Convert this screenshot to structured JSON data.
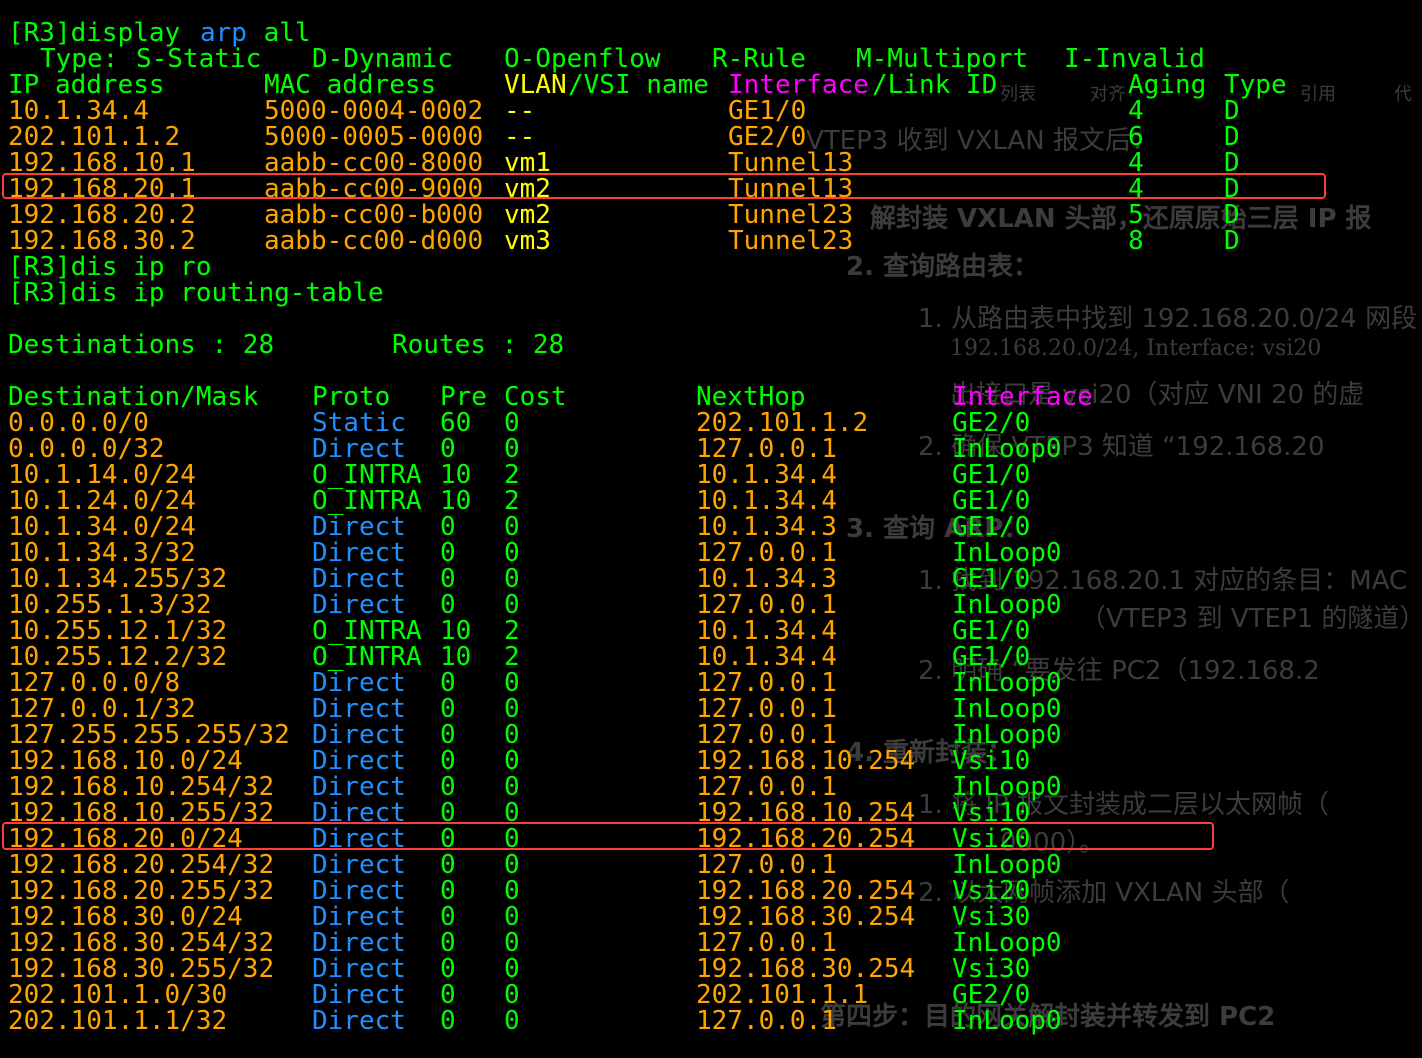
{
  "arp": {
    "command": "[R3]display arp all",
    "cmd_prefix": "[R3]display ",
    "cmd_arp": "arp",
    "cmd_all": " all",
    "legend": {
      "type": "Type:",
      "static": "S-Static",
      "dynamic": "D-Dynamic",
      "openflow": "O-Openflow",
      "rule": "R-Rule",
      "multiport": "M-Multiport",
      "invalid": "I-Invalid"
    },
    "headers": {
      "ip": "IP address",
      "mac": "MAC address",
      "vlan_vsi": "VLAN/VSI name",
      "vlan_vsi_a": "VLAN",
      "vlan_vsi_b": "/VSI name",
      "interface": "Interface",
      "link_id": "/Link ID",
      "aging": "Aging",
      "type": "Type"
    },
    "rows": [
      {
        "ip": "10.1.34.4",
        "mac": "5000-0004-0002",
        "vlan": "--",
        "iface": "GE1/0",
        "aging": "4",
        "type": "D"
      },
      {
        "ip": "202.101.1.2",
        "mac": "5000-0005-0000",
        "vlan": "--",
        "iface": "GE2/0",
        "aging": "6",
        "type": "D"
      },
      {
        "ip": "192.168.10.1",
        "mac": "aabb-cc00-8000",
        "vlan": "vm1",
        "iface": "Tunnel13",
        "aging": "4",
        "type": "D"
      },
      {
        "ip": "192.168.20.1",
        "mac": "aabb-cc00-9000",
        "vlan": "vm2",
        "iface": "Tunnel13",
        "aging": "4",
        "type": "D"
      },
      {
        "ip": "192.168.20.2",
        "mac": "aabb-cc00-b000",
        "vlan": "vm2",
        "iface": "Tunnel23",
        "aging": "5",
        "type": "D"
      },
      {
        "ip": "192.168.30.2",
        "mac": "aabb-cc00-d000",
        "vlan": "vm3",
        "iface": "Tunnel23",
        "aging": "8",
        "type": "D"
      }
    ]
  },
  "commands": {
    "dis_ip_ro": "[R3]dis ip ro",
    "dis_ip_routing_table": "[R3]dis ip routing-table"
  },
  "routing": {
    "destinations_label": "Destinations : 28",
    "routes_label": "Routes : 28",
    "headers": {
      "dest": "Destination/Mask",
      "proto": "Proto",
      "pre": "Pre",
      "cost": "Cost",
      "nexthop": "NextHop",
      "interface": "Interface"
    },
    "rows": [
      {
        "dest": "0.0.0.0/0",
        "proto": "Static",
        "pre": "60",
        "cost": "0",
        "nexthop": "202.101.1.2",
        "iface": "GE2/0"
      },
      {
        "dest": "0.0.0.0/32",
        "proto": "Direct",
        "pre": "0",
        "cost": "0",
        "nexthop": "127.0.0.1",
        "iface": "InLoop0"
      },
      {
        "dest": "10.1.14.0/24",
        "proto": "O_INTRA",
        "pre": "10",
        "cost": "2",
        "nexthop": "10.1.34.4",
        "iface": "GE1/0"
      },
      {
        "dest": "10.1.24.0/24",
        "proto": "O_INTRA",
        "pre": "10",
        "cost": "2",
        "nexthop": "10.1.34.4",
        "iface": "GE1/0"
      },
      {
        "dest": "10.1.34.0/24",
        "proto": "Direct",
        "pre": "0",
        "cost": "0",
        "nexthop": "10.1.34.3",
        "iface": "GE1/0"
      },
      {
        "dest": "10.1.34.3/32",
        "proto": "Direct",
        "pre": "0",
        "cost": "0",
        "nexthop": "127.0.0.1",
        "iface": "InLoop0"
      },
      {
        "dest": "10.1.34.255/32",
        "proto": "Direct",
        "pre": "0",
        "cost": "0",
        "nexthop": "10.1.34.3",
        "iface": "GE1/0"
      },
      {
        "dest": "10.255.1.3/32",
        "proto": "Direct",
        "pre": "0",
        "cost": "0",
        "nexthop": "127.0.0.1",
        "iface": "InLoop0"
      },
      {
        "dest": "10.255.12.1/32",
        "proto": "O_INTRA",
        "pre": "10",
        "cost": "2",
        "nexthop": "10.1.34.4",
        "iface": "GE1/0"
      },
      {
        "dest": "10.255.12.2/32",
        "proto": "O_INTRA",
        "pre": "10",
        "cost": "2",
        "nexthop": "10.1.34.4",
        "iface": "GE1/0"
      },
      {
        "dest": "127.0.0.0/8",
        "proto": "Direct",
        "pre": "0",
        "cost": "0",
        "nexthop": "127.0.0.1",
        "iface": "InLoop0"
      },
      {
        "dest": "127.0.0.1/32",
        "proto": "Direct",
        "pre": "0",
        "cost": "0",
        "nexthop": "127.0.0.1",
        "iface": "InLoop0"
      },
      {
        "dest": "127.255.255.255/32",
        "proto": "Direct",
        "pre": "0",
        "cost": "0",
        "nexthop": "127.0.0.1",
        "iface": "InLoop0"
      },
      {
        "dest": "192.168.10.0/24",
        "proto": "Direct",
        "pre": "0",
        "cost": "0",
        "nexthop": "192.168.10.254",
        "iface": "Vsi10"
      },
      {
        "dest": "192.168.10.254/32",
        "proto": "Direct",
        "pre": "0",
        "cost": "0",
        "nexthop": "127.0.0.1",
        "iface": "InLoop0"
      },
      {
        "dest": "192.168.10.255/32",
        "proto": "Direct",
        "pre": "0",
        "cost": "0",
        "nexthop": "192.168.10.254",
        "iface": "Vsi10"
      },
      {
        "dest": "192.168.20.0/24",
        "proto": "Direct",
        "pre": "0",
        "cost": "0",
        "nexthop": "192.168.20.254",
        "iface": "Vsi20"
      },
      {
        "dest": "192.168.20.254/32",
        "proto": "Direct",
        "pre": "0",
        "cost": "0",
        "nexthop": "127.0.0.1",
        "iface": "InLoop0"
      },
      {
        "dest": "192.168.20.255/32",
        "proto": "Direct",
        "pre": "0",
        "cost": "0",
        "nexthop": "192.168.20.254",
        "iface": "Vsi20"
      },
      {
        "dest": "192.168.30.0/24",
        "proto": "Direct",
        "pre": "0",
        "cost": "0",
        "nexthop": "192.168.30.254",
        "iface": "Vsi30"
      },
      {
        "dest": "192.168.30.254/32",
        "proto": "Direct",
        "pre": "0",
        "cost": "0",
        "nexthop": "127.0.0.1",
        "iface": "InLoop0"
      },
      {
        "dest": "192.168.30.255/32",
        "proto": "Direct",
        "pre": "0",
        "cost": "0",
        "nexthop": "192.168.30.254",
        "iface": "Vsi30"
      },
      {
        "dest": "202.101.1.0/30",
        "proto": "Direct",
        "pre": "0",
        "cost": "0",
        "nexthop": "202.101.1.1",
        "iface": "GE2/0"
      },
      {
        "dest": "202.101.1.1/32",
        "proto": "Direct",
        "pre": "0",
        "cost": "0",
        "nexthop": "127.0.0.1",
        "iface": "InLoop0"
      }
    ]
  },
  "highlights": {
    "color": "#ff3b3b",
    "arp_row_index": 3,
    "route_row_index": 16
  },
  "ghost_text": [
    "VTEP3 收到 VXLAN 报文后：",
    "解封装 VXLAN 头部，还原原始三层 IP 报",
    "2. 查询路由表：",
    "1. 从路由表中找到 192.168.20.0/24 网段",
    "192.168.20.0/24, Interface: vsi20",
    "出接口是 vsi20（对应 VNI 20 的虚",
    "2. 确保 VTEP3 知道 “192.168.20",
    "3. 查询 ARP：",
    "1. 找到 192.168.20.1 对应的条目：MAC",
    "（VTEP3 到 VTEP1 的隧道）",
    "2. 明确 “要发往 PC2（192.168.2",
    "4. 重新封装：",
    "1. 将 IP 报文封装成二层以太网帧（",
    "0000）。",
    "2. 以太网帧添加 VXLAN 头部（",
    "第四步：目的网关解封装并转发到 PC2",
    "列表",
    "对齐",
    "引用",
    "代"
  ],
  "colors": {
    "background": "#000000",
    "green": "#00ff00",
    "orange": "#ffa500",
    "blue": "#1e90ff",
    "magenta": "#ff00ff",
    "yellow": "#ffff00"
  }
}
